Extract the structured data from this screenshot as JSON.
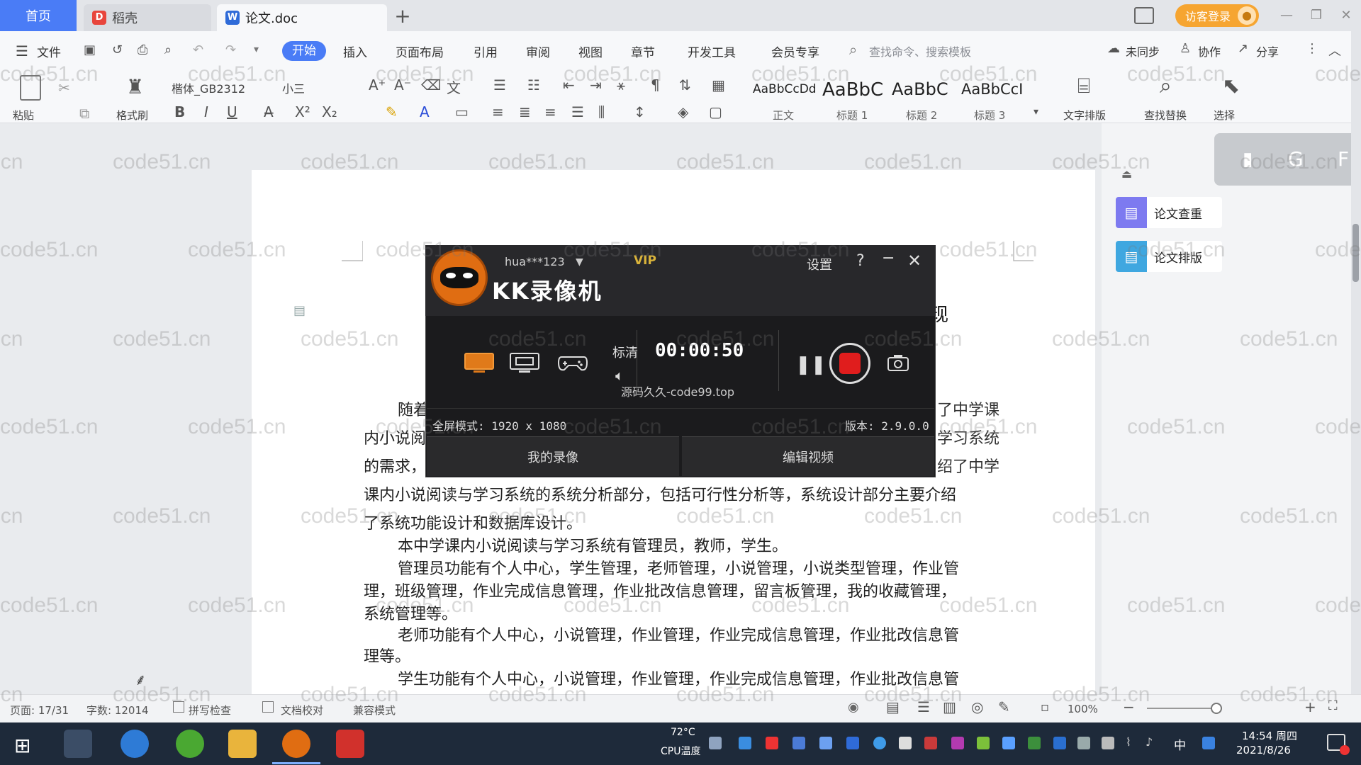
{
  "tabs": {
    "home": "首页",
    "docer": "稻壳",
    "doc": "论文.doc",
    "add": "+",
    "guest_login": "访客登录"
  },
  "menu": {
    "file": "文件",
    "items": [
      "开始",
      "插入",
      "页面布局",
      "引用",
      "审阅",
      "视图",
      "章节",
      "开发工具",
      "会员专享"
    ],
    "search_placeholder": "查找命令、搜索模板",
    "sync": "未同步",
    "collab": "协作",
    "share": "分享"
  },
  "ribbon": {
    "paste": "粘贴",
    "format_painter": "格式刷",
    "font_name": "楷体_GB2312",
    "font_size": "小三",
    "styles": [
      {
        "sample": "AaBbCcDd",
        "label": "正文"
      },
      {
        "sample": "AaBbC",
        "label": "标题 1"
      },
      {
        "sample": "AaBbC",
        "label": "标题 2"
      },
      {
        "sample": "AaBbCcI",
        "label": "标题 3"
      }
    ],
    "text_tools": "文字排版",
    "find_replace": "查找替换",
    "select": "选择"
  },
  "document": {
    "title_tail": "现",
    "lines": [
      {
        "text": "随着",
        "indent": true
      },
      {
        "text": "内小说阅",
        "indent": false
      },
      {
        "text": "的需求，",
        "indent": false
      },
      {
        "text": "课内小说阅读与学习系统的系统分析部分，包括可行性分析等，系统设计部分主要介绍",
        "indent": false
      },
      {
        "text": "了系统功能设计和数据库设计。",
        "indent": false
      },
      {
        "text": "本中学课内小说阅读与学习系统有管理员，教师，学生。",
        "indent": true
      },
      {
        "text": "管理员功能有个人中心，学生管理，老师管理，小说管理，小说类型管理，作业管",
        "indent": true
      },
      {
        "text": "理，班级管理，作业完成信息管理，作业批改信息管理，留言板管理，我的收藏管理，",
        "indent": false
      },
      {
        "text": "系统管理等。",
        "indent": false
      },
      {
        "text": "老师功能有个人中心，小说管理，作业管理，作业完成信息管理，作业批改信息管",
        "indent": true
      },
      {
        "text": "理等。",
        "indent": false
      },
      {
        "text": "学生功能有个人中心，小说管理，作业管理，作业完成信息管理，作业批改信息管",
        "indent": true
      }
    ],
    "right_fragments": [
      "了中学课",
      "学习系统",
      "绍了中学"
    ]
  },
  "right_panel": {
    "check": "论文查重",
    "layout": "论文排版"
  },
  "recorder": {
    "user": "hua***123",
    "vip": "VIP",
    "title": "KK录像机",
    "settings": "设置",
    "help": "?",
    "quality": "标清",
    "elapsed": "00:00:50",
    "watermark": "源码久久-code99.top",
    "mode": "全屏模式: 1920 x 1080",
    "version": "版本: 2.9.0.0",
    "my_recordings": "我的录像",
    "edit_video": "编辑视频"
  },
  "status": {
    "page": "页面: 17/31",
    "words": "字数: 12014",
    "spellcheck": "拼写检查",
    "proofread": "文档校对",
    "compat_mode": "兼容模式",
    "zoom": "100%"
  },
  "taskbar": {
    "cpu_temp": "72°C",
    "cpu_label": "CPU温度",
    "time": "14:54 周四",
    "date": "2021/8/26",
    "lang": "中"
  },
  "watermark_text": "code51.cn",
  "colors": {
    "accent": "#4a7cf6",
    "guest": "#f6a531",
    "record_red": "#e01d1d",
    "kk_orange": "#e06d12"
  }
}
